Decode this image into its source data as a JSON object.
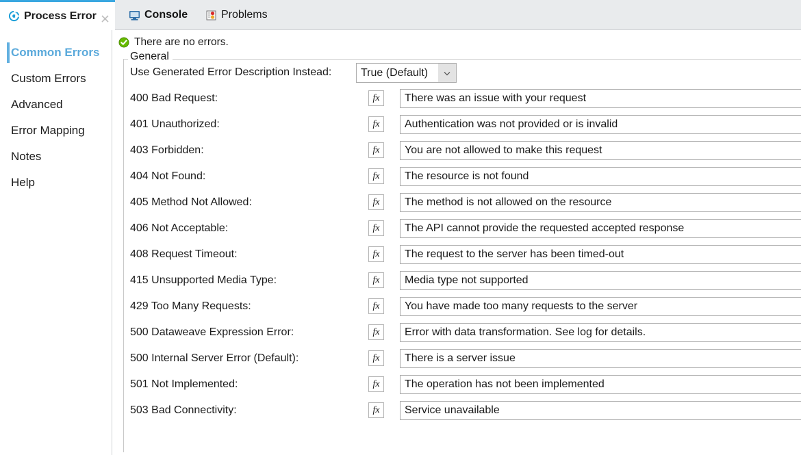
{
  "tabs": [
    {
      "label": "Process Error",
      "icon": "mule-circle-icon",
      "active": true,
      "closable": true
    },
    {
      "label": "Console",
      "icon": "console-monitor-icon",
      "active": false,
      "closable": false
    },
    {
      "label": "Problems",
      "icon": "problems-stoplight-icon",
      "active": false,
      "closable": false
    }
  ],
  "sidebar": {
    "items": [
      {
        "label": "Common Errors",
        "selected": true
      },
      {
        "label": "Custom Errors",
        "selected": false
      },
      {
        "label": "Advanced",
        "selected": false
      },
      {
        "label": "Error Mapping",
        "selected": false
      },
      {
        "label": "Notes",
        "selected": false
      },
      {
        "label": "Help",
        "selected": false
      }
    ]
  },
  "status": {
    "icon": "green-check-icon",
    "text": "There are no errors."
  },
  "group": {
    "legend": "General",
    "dropdown_row": {
      "label": "Use Generated Error Description Instead:",
      "value": "True (Default)",
      "arrow_icon": "chevron-down-icon"
    },
    "fx_label": "fx",
    "rows": [
      {
        "label": "400 Bad Request:",
        "value": "There was an issue with your request"
      },
      {
        "label": "401 Unauthorized:",
        "value": "Authentication was not provided or is invalid"
      },
      {
        "label": "403 Forbidden:",
        "value": "You are not allowed to make this request"
      },
      {
        "label": "404 Not Found:",
        "value": "The resource is not found"
      },
      {
        "label": "405 Method Not Allowed:",
        "value": "The method is not allowed on the resource"
      },
      {
        "label": "406 Not Acceptable:",
        "value": "The API cannot provide the requested accepted response"
      },
      {
        "label": "408 Request Timeout:",
        "value": "The request to the server has been timed-out"
      },
      {
        "label": "415 Unsupported Media Type:",
        "value": "Media type not supported"
      },
      {
        "label": "429 Too Many Requests:",
        "value": "You have made too many requests to the server"
      },
      {
        "label": "500 Dataweave Expression Error:",
        "value": "Error with data transformation.  See log for details."
      },
      {
        "label": "500 Internal Server Error (Default):",
        "value": "There is a server issue"
      },
      {
        "label": "501 Not Implemented:",
        "value": "The operation has not been implemented"
      },
      {
        "label": "503 Bad Connectivity:",
        "value": "Service unavailable"
      }
    ]
  },
  "colors": {
    "accent": "#3aa7e0",
    "selected_text": "#5aa9db",
    "tabbar_bg": "#e9ebed",
    "status_ok": "#5cb300"
  }
}
